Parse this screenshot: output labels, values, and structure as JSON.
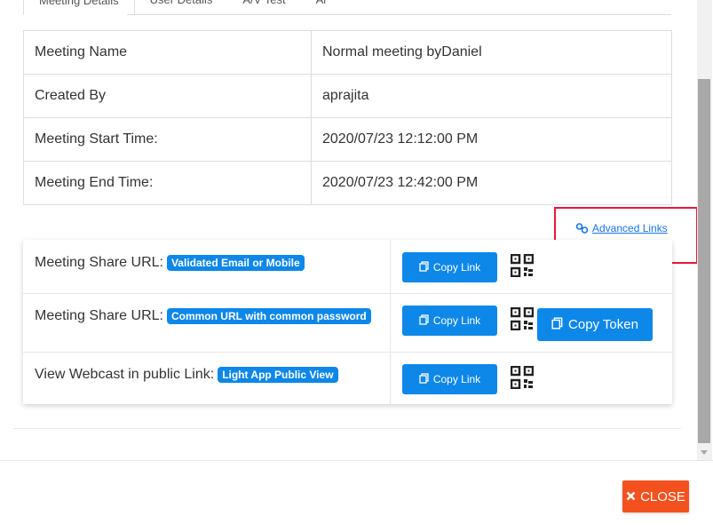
{
  "tabs": [
    {
      "label": "Meeting Details"
    },
    {
      "label": "User Details"
    },
    {
      "label": "A/V Test"
    },
    {
      "label": "Al"
    }
  ],
  "details": [
    {
      "label": "Meeting Name",
      "value": "Normal meeting byDaniel"
    },
    {
      "label": "Created By",
      "value": "aprajita"
    },
    {
      "label": "Meeting Start Time:",
      "value": "2020/07/23 12:12:00 PM"
    },
    {
      "label": "Meeting End Time:",
      "value": "2020/07/23 12:42:00 PM"
    }
  ],
  "advanced_links": {
    "label": "Advanced Links",
    "icon": "link-icon"
  },
  "share_rows": [
    {
      "label": "Meeting Share URL:",
      "badge": "Validated Email or Mobile",
      "copy_label": "Copy Link"
    },
    {
      "label": "Meeting Share URL:",
      "badge": "Common URL with common password",
      "copy_label": "Copy Link"
    },
    {
      "label": "View Webcast in public Link:",
      "badge": "Light App Public View",
      "copy_label": "Copy Link"
    }
  ],
  "copy_token": {
    "label": "Copy Token"
  },
  "close_button": {
    "label": "CLOSE"
  },
  "colors": {
    "primary": "#0d87e8",
    "close": "#f4511e",
    "highlight": "#e8173c",
    "link": "#1a73e8"
  }
}
